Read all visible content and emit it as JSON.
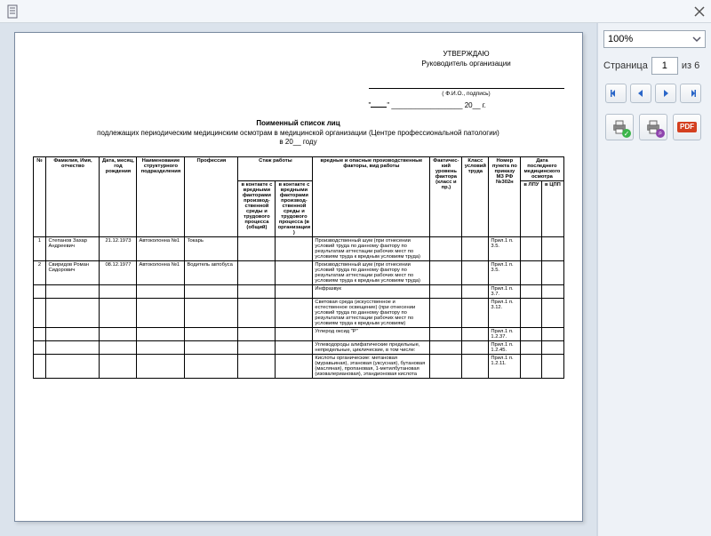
{
  "window": {
    "doc_icon_label": "document-icon",
    "close_icon_label": "close-icon"
  },
  "sidebar": {
    "zoom_value": "100%",
    "page_label": "Страница",
    "page_current": "1",
    "page_total_label": "из 6"
  },
  "page": {
    "approval": {
      "approve_caption": "УТВЕРЖДАЮ",
      "manager_caption": "Руководитель организации",
      "sign_caption": "( Ф.И.О., подпись)",
      "date_prefix": "\"",
      "date_middle": "\" __________________ 20__ г."
    },
    "title": {
      "line1": "Поименный список лиц",
      "line2": "подлежащих периодическим медицинским осмотрам в медицинской организации (Центре профессиональной патологии)",
      "line3": "в 20__ году"
    },
    "table": {
      "headers": {
        "n": "№",
        "fio": "Фамилия, Имя, отчество",
        "dob": "Дата, месяц, год рождения",
        "unit": "Наименование структурного подразделения",
        "prof": "Профессия",
        "exp": "Стаж работы",
        "exp1": "в контакте с вредными факторами производ­ственной среды и трудового процесса (общий)",
        "exp2": "в контакте с вредными факторами производ­ственной среды и трудового процесса (в организации)",
        "factors": "вредные и опасные производственные факторы, вид работы",
        "level": "Фактичес­кий уровень фактора (класс и пр.)",
        "class": "Класс условий труда",
        "order": "Номер пункта по приказу МЗ РФ №302н",
        "last": "Дата последнего медицинского осмотра",
        "lpu": "в ЛПУ",
        "cpp": "в ЦПП"
      },
      "rows": [
        {
          "n": "1",
          "fio": "Степанов Захар Андреевич",
          "dob": "21.12.1973",
          "unit": "Автоколонна №1",
          "prof": "Токарь",
          "factors": "Производственный шум (при отнесении условий труда по данному фактору по результатам аттестации рабочих мест по условиям труда к вредным условиям труда)",
          "order": "Прил.1 п. 3.5."
        },
        {
          "n": "2",
          "fio": "Свиридов Роман Сидорович",
          "dob": "08.12.1977",
          "unit": "Автоколонна №1",
          "prof": "Водитель автобуса",
          "factors": "Производственный шум (при отнесении условий труда по данному фактору по результатам аттестации рабочих мест по условиям труда к вредным условиям труда)",
          "order": "Прил.1 п. 3.5."
        },
        {
          "n": "",
          "fio": "",
          "dob": "",
          "unit": "",
          "prof": "",
          "factors": "Инфразвук",
          "order": "Прил.1 п. 3.7."
        },
        {
          "n": "",
          "fio": "",
          "dob": "",
          "unit": "",
          "prof": "",
          "factors": "Световая среда (искусственное и естественное освещение) (при отнесении условий труда по данному фактору по результатам аттестации рабочих мест по условиям труда к вредным условиям)",
          "order": "Прил.1 п. 3.12."
        },
        {
          "n": "",
          "fio": "",
          "dob": "",
          "unit": "",
          "prof": "",
          "factors": "Углерод оксид \"Р\"",
          "order": "Прил.1 п. 1.2.37."
        },
        {
          "n": "",
          "fio": "",
          "dob": "",
          "unit": "",
          "prof": "",
          "factors": "Углеводороды алифатические предельные, непредельные, циклические, в том числе:",
          "order": "Прил.1 п. 1.2.45."
        },
        {
          "n": "",
          "fio": "",
          "dob": "",
          "unit": "",
          "prof": "",
          "factors": "Кислоты органические: метановая (муравьиная), этановая (уксусная), бутановая (масляная), пропановая, 1-метилбутановая (изовалериановая), этандионовая кислота",
          "order": "Прил.1 п. 1.2.11."
        }
      ]
    }
  }
}
